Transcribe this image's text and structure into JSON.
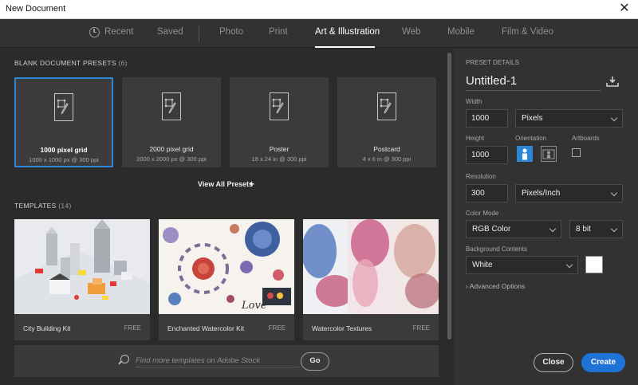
{
  "window": {
    "title": "New Document",
    "close_glyph": "✕"
  },
  "tabs": [
    {
      "label": "Recent",
      "icon": "clock-icon"
    },
    {
      "label": "Saved"
    },
    {
      "label": "Photo"
    },
    {
      "label": "Print"
    },
    {
      "label": "Art & Illustration",
      "active": true
    },
    {
      "label": "Web"
    },
    {
      "label": "Mobile"
    },
    {
      "label": "Film & Video"
    }
  ],
  "presets_section": {
    "label": "BLANK DOCUMENT PRESETS",
    "count": "(6)"
  },
  "presets": [
    {
      "name": "1000 pixel grid",
      "sub": "1000 x 1000 px @ 300 ppi",
      "selected": true
    },
    {
      "name": "2000 pixel grid",
      "sub": "2000 x 2000 px @ 300 ppi"
    },
    {
      "name": "Poster",
      "sub": "18 x 24 in @ 300 ppi"
    },
    {
      "name": "Postcard",
      "sub": "4 x 6 in @ 300 ppi"
    }
  ],
  "view_all": {
    "label": "View All Presets",
    "icon": "plus-icon"
  },
  "templates_section": {
    "label": "TEMPLATES",
    "count": "(14)"
  },
  "templates": [
    {
      "name": "City Building Kit",
      "badge": "FREE"
    },
    {
      "name": "Enchanted Watercolor Kit",
      "badge": "FREE"
    },
    {
      "name": "Watercolor Textures",
      "badge": "FREE"
    }
  ],
  "search": {
    "placeholder": "Find more templates on Adobe Stock",
    "go_label": "Go"
  },
  "details": {
    "section_label": "PRESET DETAILS",
    "doc_name": "Untitled-1",
    "width_label": "Width",
    "width_value": "1000",
    "width_unit": "Pixels",
    "height_label": "Height",
    "height_value": "1000",
    "orientation_label": "Orientation",
    "orientation_selected": "portrait",
    "artboards_label": "Artboards",
    "artboards_checked": false,
    "resolution_label": "Resolution",
    "resolution_value": "300",
    "resolution_unit": "Pixels/Inch",
    "color_mode_label": "Color Mode",
    "color_mode": "RGB Color",
    "bit_depth": "8 bit",
    "background_label": "Background Contents",
    "background": "White",
    "background_color": "#ffffff",
    "advanced_label": "Advanced Options",
    "advanced_glyph": "›"
  },
  "actions": {
    "close_label": "Close",
    "create_label": "Create",
    "create_color": "#1f73d6"
  }
}
